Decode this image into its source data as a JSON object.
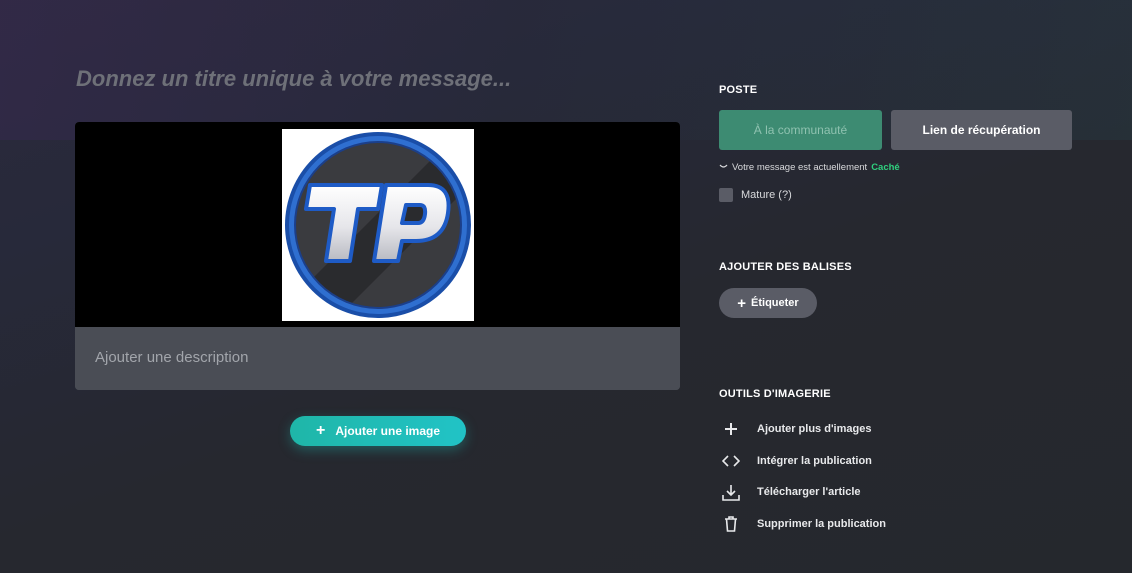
{
  "editor": {
    "title_placeholder": "Donnez un titre unique à votre message...",
    "logo_alt": "TP",
    "description_placeholder": "Ajouter une description",
    "add_image_label": "Ajouter une image"
  },
  "sidebar": {
    "post_heading": "POSTE",
    "community_button": "À la communauté",
    "link_button": "Lien de récupération",
    "status_text": "Votre message est actuellement",
    "status_value": "Caché",
    "mature_label": "Mature (?)",
    "tags_heading": "AJOUTER DES BALISES",
    "tag_button": "Étiqueter",
    "tools_heading": "OUTILS D'IMAGERIE",
    "tools": [
      {
        "label": "Ajouter plus d'images",
        "icon": "plus-icon"
      },
      {
        "label": "Intégrer la publication",
        "icon": "code-icon"
      },
      {
        "label": "Télécharger l'article",
        "icon": "download-icon"
      },
      {
        "label": "Supprimer la publication",
        "icon": "trash-icon"
      }
    ]
  },
  "colors": {
    "background": "#26282f",
    "accent_teal": "#21c3c6",
    "community_green": "#3d8b72",
    "status_green": "#2fd07e",
    "button_gray": "#5a5c66"
  }
}
